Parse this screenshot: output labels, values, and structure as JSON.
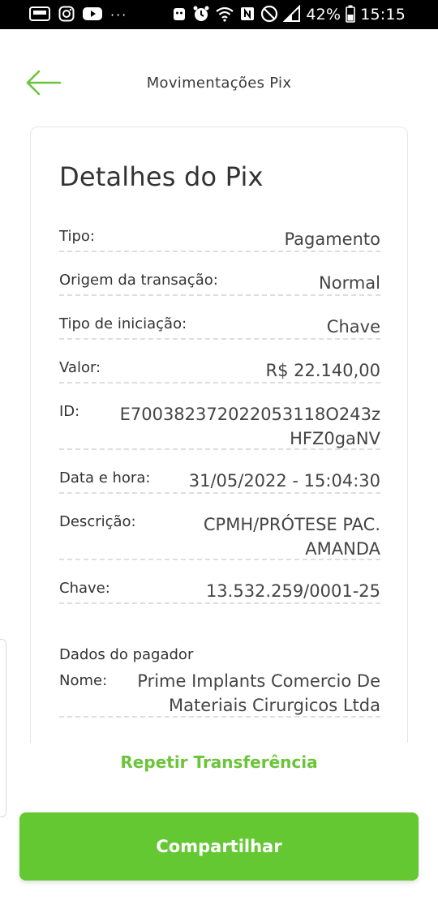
{
  "status_bar": {
    "battery": "42%",
    "time": "15:15",
    "more": "···"
  },
  "header": {
    "title": "Movimentações Pix"
  },
  "card": {
    "title": "Detalhes do Pix",
    "rows": [
      {
        "label": "Tipo:",
        "value": "Pagamento"
      },
      {
        "label": "Origem da transação:",
        "value": "Normal"
      },
      {
        "label": "Tipo de iniciação:",
        "value": "Chave"
      },
      {
        "label": "Valor:",
        "value": "R$ 22.140,00"
      },
      {
        "label": "ID:",
        "value_line1": "E700382372022053118O243z",
        "value_line2": "HFZ0gaNV"
      },
      {
        "label": "Data e hora:",
        "value": "31/05/2022 - 15:04:30"
      },
      {
        "label": "Descrição:",
        "value_line1": "CPMH/PRÓTESE PAC.",
        "value_line2": "AMANDA"
      },
      {
        "label": "Chave:",
        "value": "13.532.259/0001-25"
      }
    ],
    "payer": {
      "section_title": "Dados do pagador",
      "name_label": "Nome:",
      "name_line1": "Prime Implants Comercio De",
      "name_line2": "Materiais Cirurgicos Ltda"
    }
  },
  "actions": {
    "repeat_label": "Repetir Transferência",
    "share_label": "Compartilhar"
  },
  "colors": {
    "accent": "#64c832",
    "link": "#6bc43a"
  }
}
